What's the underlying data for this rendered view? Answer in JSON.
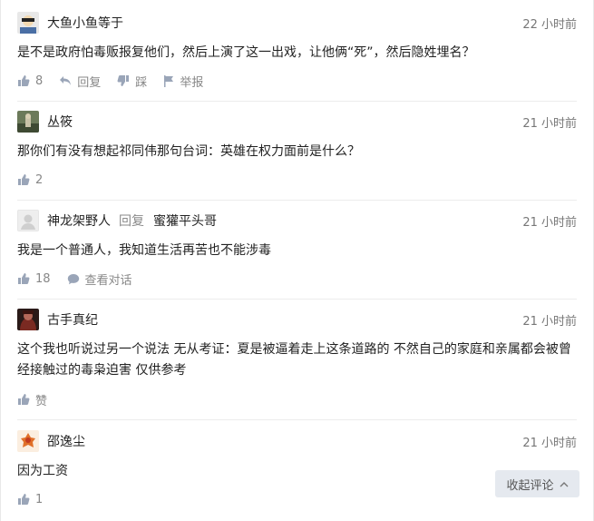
{
  "comments": [
    {
      "user": "大鱼小鱼等于",
      "time": "22 小时前",
      "text": "是不是政府怕毒贩报复他们，然后上演了这一出戏，让他俩“死”，然后隐姓埋名？",
      "likes": "8",
      "reply_label": "回复",
      "dislike_label": "踩",
      "report_label": "举报"
    },
    {
      "user": "丛筱",
      "time": "21 小时前",
      "text": "那你们有没有想起祁同伟那句台词：英雄在权力面前是什么？",
      "likes": "2"
    },
    {
      "user": "神龙架野人",
      "reply_word": "回复",
      "reply_to": "蜜獾平头哥",
      "time": "21 小时前",
      "text": "我是一个普通人，我知道生活再苦也不能涉毒",
      "likes": "18",
      "conversation_label": "查看对话"
    },
    {
      "user": "古手真纪",
      "time": "21 小时前",
      "text": "这个我也听说过另一个说法 无从考证：夏是被逼着走上这条道路的 不然自己的家庭和亲属都会被曾经接触过的毒枭迫害 仅供参考",
      "likes": "赞"
    },
    {
      "user": "邵逸尘",
      "time": "21 小时前",
      "text": "因为工资",
      "likes": "1"
    }
  ],
  "collapse_label": "收起评论",
  "colors": {
    "muted": "#888888",
    "divider": "#ececec",
    "collapse_bg": "#e5e9ef"
  },
  "icons": [
    "thumb-up-icon",
    "reply-arrow-icon",
    "thumb-down-icon",
    "flag-icon",
    "chat-bubble-icon",
    "chevron-up-icon"
  ]
}
